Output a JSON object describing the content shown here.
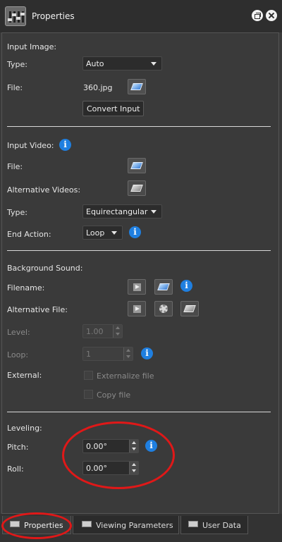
{
  "window": {
    "title": "Properties"
  },
  "input_image": {
    "header": "Input Image:",
    "type_label": "Type:",
    "type_value": "Auto",
    "file_label": "File:",
    "file_value": "360.jpg",
    "convert_label": "Convert Input"
  },
  "input_video": {
    "header": "Input Video:",
    "file_label": "File:",
    "alt_label": "Alternative Videos:",
    "type_label": "Type:",
    "type_value": "Equirectangular",
    "end_label": "End Action:",
    "end_value": "Loop"
  },
  "background_sound": {
    "header": "Background Sound:",
    "filename_label": "Filename:",
    "alt_file_label": "Alternative File:",
    "level_label": "Level:",
    "level_value": "1.00",
    "loop_label": "Loop:",
    "loop_value": "1",
    "external_label": "External:",
    "externalize_label": "Externalize file",
    "copy_label": "Copy file"
  },
  "leveling": {
    "header": "Leveling:",
    "pitch_label": "Pitch:",
    "pitch_value": "0.00°",
    "roll_label": "Roll:",
    "roll_value": "0.00°"
  },
  "tabs": [
    {
      "label": "Properties",
      "active": true
    },
    {
      "label": "Viewing Parameters",
      "active": false
    },
    {
      "label": "User Data",
      "active": false
    }
  ],
  "colors": {
    "info_blue": "#1f7fe0",
    "annotation_red": "#e01818",
    "panel_bg": "#3a3a3a"
  }
}
